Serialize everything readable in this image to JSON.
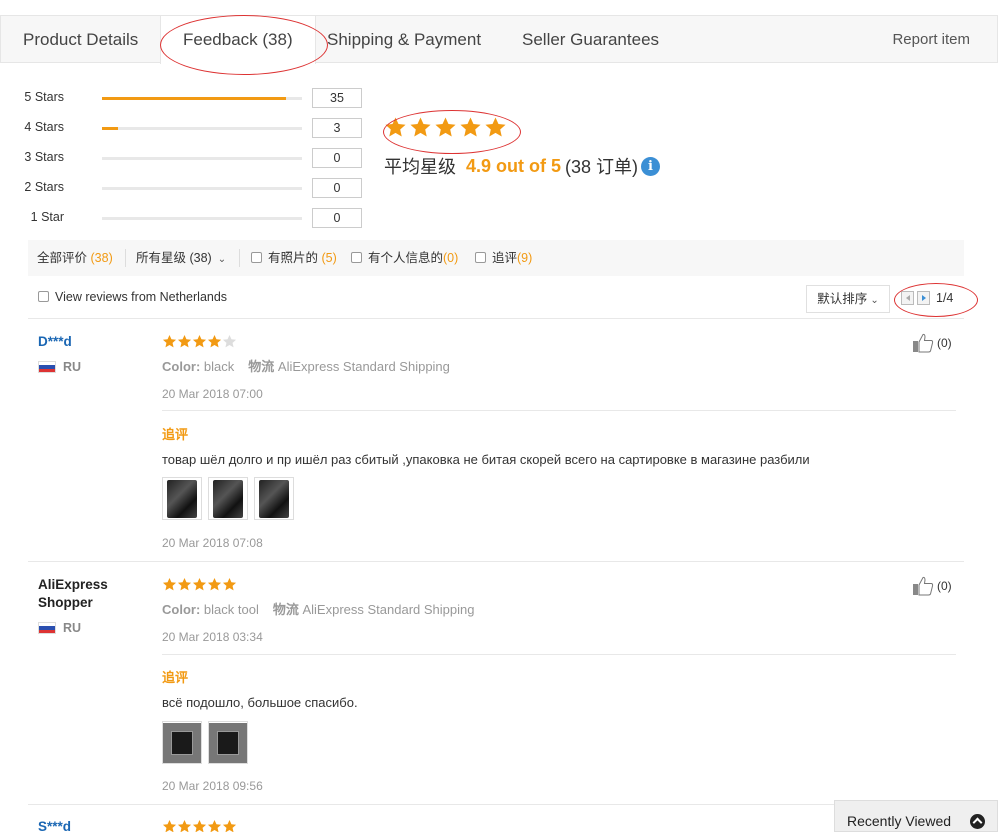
{
  "tabs": [
    {
      "label": "Product Details"
    },
    {
      "label": "Feedback (38)"
    },
    {
      "label": "Shipping & Payment"
    },
    {
      "label": "Seller Guarantees"
    }
  ],
  "report_label": "Report item",
  "rating_breakdown": [
    {
      "label": "5 Stars",
      "count": "35",
      "fraction": 0.921
    },
    {
      "label": "4 Stars",
      "count": "3",
      "fraction": 0.079
    },
    {
      "label": "3 Stars",
      "count": "0",
      "fraction": 0
    },
    {
      "label": "2 Stars",
      "count": "0",
      "fraction": 0
    },
    {
      "label": "1 Star",
      "count": "0",
      "fraction": 0
    }
  ],
  "average": {
    "stars": 5,
    "prefix": "平均星级",
    "value": "4.9 out of 5",
    "suffix": "(38 订单)",
    "info_icon": "i"
  },
  "filters": {
    "all_label": "全部评价",
    "all_count": "(38)",
    "stars_label": "所有星级 (38)",
    "photos_label": "有照片的",
    "photos_count": "(5)",
    "personal_label": "有个人信息的",
    "personal_count": "(0)",
    "additional_label": "追评",
    "additional_count": "(9)"
  },
  "view_local_label": "View reviews from Netherlands",
  "sort_label": "默认排序",
  "pager": {
    "text": "1/4"
  },
  "colors": {
    "accent": "#f29a13",
    "link": "#1a66b3",
    "annotation": "#dd3333"
  },
  "reviews": [
    {
      "user": "D***d",
      "country": "RU",
      "rating": 4,
      "color_label": "Color:",
      "color_value": "black",
      "shipping_label": "物流",
      "shipping_value": "AliExpress Standard Shipping",
      "date": "20 Mar 2018 07:00",
      "additional_label": "追评",
      "text": "товар шёл долго и пр ишёл раз сбитый ,упаковка не битая скорей всего на сартировке в магазине разбили",
      "photo_count": 3,
      "additional_date": "20 Mar 2018 07:08",
      "helpful": "(0)"
    },
    {
      "user": "AliExpress Shopper",
      "user_line1": "AliExpress",
      "user_line2": "Shopper",
      "country": "RU",
      "rating": 5,
      "color_label": "Color:",
      "color_value": "black tool",
      "shipping_label": "物流",
      "shipping_value": "AliExpress Standard Shipping",
      "date": "20 Mar 2018 03:34",
      "additional_label": "追评",
      "text": "всё подошло, большое спасибо.",
      "photo_count": 2,
      "additional_date": "20 Mar 2018 09:56",
      "helpful": "(0)"
    },
    {
      "user": "S***d",
      "rating": 5
    }
  ],
  "recently_viewed_label": "Recently Viewed"
}
